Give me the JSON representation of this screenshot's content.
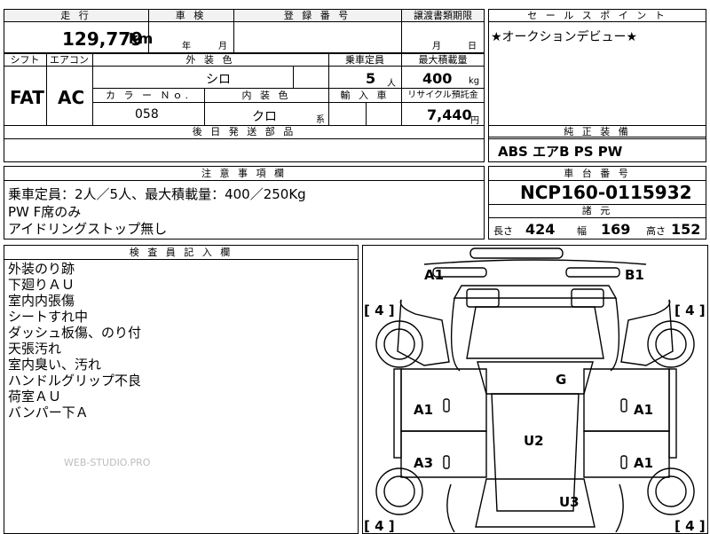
{
  "top": {
    "mileage_header": "走 行",
    "inspection_header": "車 検",
    "reg_header": "登 録 番 号",
    "transfer_header": "譲渡書類期限",
    "mileage_value": "129,779",
    "mileage_unit": "km",
    "year_label": "年",
    "month_label": "月",
    "t_month": "月",
    "t_day": "日"
  },
  "row2": {
    "shift_header": "シフト",
    "ac_header": "エアコン",
    "ext_color_header": "外 装 色",
    "capacity_header": "乗車定員",
    "load_header": "最大積載量",
    "shift_value": "FAT",
    "ac_value": "AC",
    "ext_color_value": "シロ",
    "capacity_value": "5",
    "capacity_unit": "人",
    "load_value": "400",
    "load_unit": "kg",
    "colorno_header": "カ ラ ー Ｎｏ.",
    "int_color_header": "内 装 色",
    "import_header": "輸 入 車",
    "recycle_header": "リサイクル預託金",
    "colorno_value": "058",
    "int_color_value": "クロ",
    "int_color_suffix": "系",
    "recycle_value": "7,440",
    "recycle_unit": "円"
  },
  "later_parts_header": "後 日 発 送 部 品",
  "sales_point": {
    "header": "セ ー ル ス ポ イ ン ト",
    "text": "★オークションデビュー★"
  },
  "equipment": {
    "header": "純 正 装 備",
    "value": "ABS エアB PS PW"
  },
  "notes": {
    "header": "注 意 事 項 欄",
    "lines": [
      "乗車定員：2人／5人、最大積載量：400／250Kg",
      "PW F席のみ",
      "アイドリングストップ無し"
    ]
  },
  "chassis": {
    "header": "車 台 番 号",
    "value": "NCP160-0115932"
  },
  "dims": {
    "header": "諸 元",
    "length_label": "長さ",
    "length_value": "424",
    "width_label": "幅",
    "width_value": "169",
    "height_label": "高さ",
    "height_value": "152"
  },
  "inspector": {
    "header": "検 査 員 記 入 欄",
    "lines": [
      "外装のり跡",
      "下廻りＡＵ",
      "室内内張傷",
      "シートすれ中",
      "ダッシュ板傷、のり付",
      "天張汚れ",
      "室内臭い、汚れ",
      "ハンドルグリップ不良",
      "荷室ＡＵ",
      "バンパー下Ａ"
    ],
    "watermark": "WEB-STUDIO.PRO"
  },
  "diagram": {
    "marks": {
      "a1_top_left": "A1",
      "b1_top_right": "B1",
      "g": "G",
      "a1_left": "A1",
      "a1_right": "A1",
      "u2": "U2",
      "a3_left": "A3",
      "a1_right_lower": "A1",
      "u3": "U3"
    },
    "tires": {
      "fl": "[ 4 ]",
      "fr": "[ 4 ]",
      "rl": "[ 4 ]",
      "rr": "[ 4 ]"
    }
  }
}
